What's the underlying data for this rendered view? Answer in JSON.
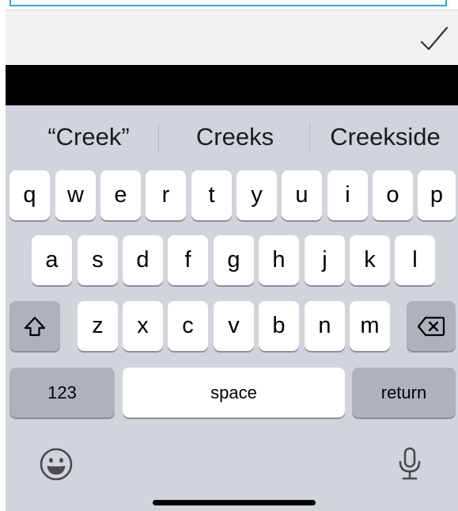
{
  "suggestions": [
    "“Creek”",
    "Creeks",
    "Creekside"
  ],
  "rows": {
    "row1": [
      "q",
      "w",
      "e",
      "r",
      "t",
      "y",
      "u",
      "i",
      "o",
      "p"
    ],
    "row2": [
      "a",
      "s",
      "d",
      "f",
      "g",
      "h",
      "j",
      "k",
      "l"
    ],
    "row3": [
      "z",
      "x",
      "c",
      "v",
      "b",
      "n",
      "m"
    ]
  },
  "keys": {
    "numbers": "123",
    "space": "space",
    "return": "return"
  },
  "icons": {
    "done": "checkmark-icon",
    "shift": "shift-icon",
    "delete": "delete-icon",
    "emoji": "emoji-icon",
    "mic": "microphone-icon"
  },
  "colors": {
    "keyboard_bg": "#d1d4db",
    "key_bg": "#ffffff",
    "modifier_key_bg": "#adb2bc",
    "accessory_bar_bg": "#f2f2f2",
    "input_border": "#3aa7c9"
  }
}
